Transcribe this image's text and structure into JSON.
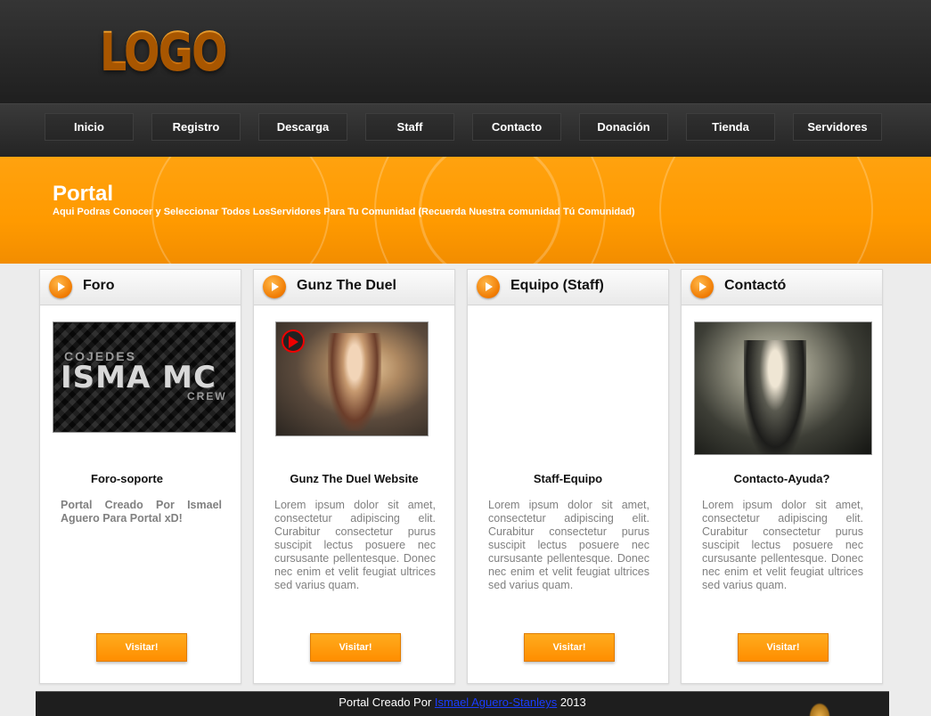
{
  "header": {
    "logo_text": "LOGO"
  },
  "nav": {
    "items": [
      "Inicio",
      "Registro",
      "Descarga",
      "Staff",
      "Contacto",
      "Donación",
      "Tienda",
      "Servidores"
    ]
  },
  "banner": {
    "title": "Portal",
    "subtitle": "Aqui Podras Conocer y Seleccionar Todos LosServidores Para Tu Comunidad (Recuerda Nuestra comunidad Tú Comunidad)"
  },
  "cards": [
    {
      "title": "Foro",
      "image_text": {
        "top": "COJEDES",
        "main": "ISMA MC",
        "bottom": "CREW"
      },
      "subtitle": "Foro-soporte",
      "text": "Portal Creado Por Ismael Aguero Para Portal xD!",
      "button": "Visitar!"
    },
    {
      "title": "Gunz The Duel",
      "subtitle": "Gunz The Duel Website",
      "text": "Lorem ipsum dolor sit amet, consectetur adipiscing elit. Curabitur consectetur purus suscipit lectus posuere nec cursusante pellentesque. Donec nec enim et velit feugiat ultrices sed varius quam.",
      "button": "Visitar!"
    },
    {
      "title": "Equipo (Staff)",
      "subtitle": "Staff-Equipo",
      "text": "Lorem ipsum dolor sit amet, consectetur adipiscing elit. Curabitur consectetur purus suscipit lectus posuere nec cursusante pellentesque. Donec nec enim et velit feugiat ultrices sed varius quam.",
      "button": "Visitar!"
    },
    {
      "title": "Contactó",
      "subtitle": "Contacto-Ayuda?",
      "text": "Lorem ipsum dolor sit amet, consectetur adipiscing elit. Curabitur consectetur purus suscipit lectus posuere nec cursusante pellentesque. Donec nec enim et velit feugiat ultrices sed varius quam.",
      "button": "Visitar!"
    }
  ],
  "footer": {
    "prefix": "Portal Creado Por ",
    "link": "Ismael Aguero-Stanleys",
    "suffix": " 2013"
  },
  "colors": {
    "accent": "#ff9a00",
    "header_bg": "#252525",
    "footer_bg": "#1e1e1e",
    "link": "#1a3dff"
  }
}
